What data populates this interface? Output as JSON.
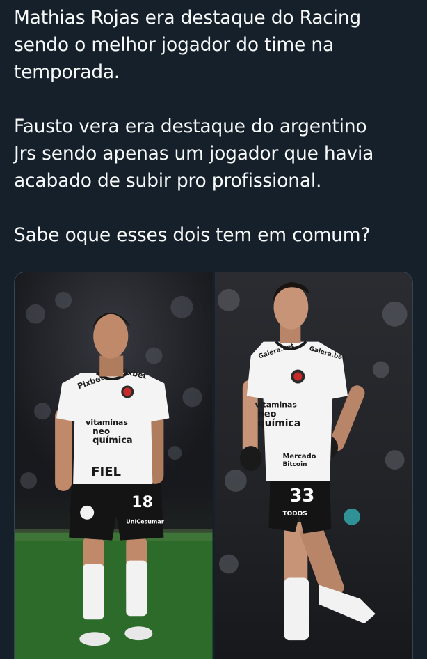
{
  "tweet": {
    "text": "Mathias Rojas era destaque do Racing\nsendo o melhor jogador do time na\ntemporada.\n\nFausto vera era destaque do argentino\nJrs sendo apenas um jogador que havia\nacabado de subir pro profissional.\n\nSabe oque esses dois tem em comum?"
  },
  "photo_left": {
    "sponsor_top": "Pixbet",
    "sponsor_chest": "vitaminas\nneo\nquímica",
    "sponsor_low": "FIEL",
    "shirt_number": "18",
    "shorts_sponsor": "UniCesumar"
  },
  "photo_right": {
    "sponsor_top": "Galera.bet",
    "sponsor_chest": "vitaminas\nneo\nquímica",
    "sponsor_low": "Mercado\nBitcoin",
    "shirt_number": "33",
    "shorts_sponsor": "TODOS"
  },
  "colors": {
    "background": "#15202b",
    "text": "#f7f9f9",
    "media_border": "#38444d"
  }
}
